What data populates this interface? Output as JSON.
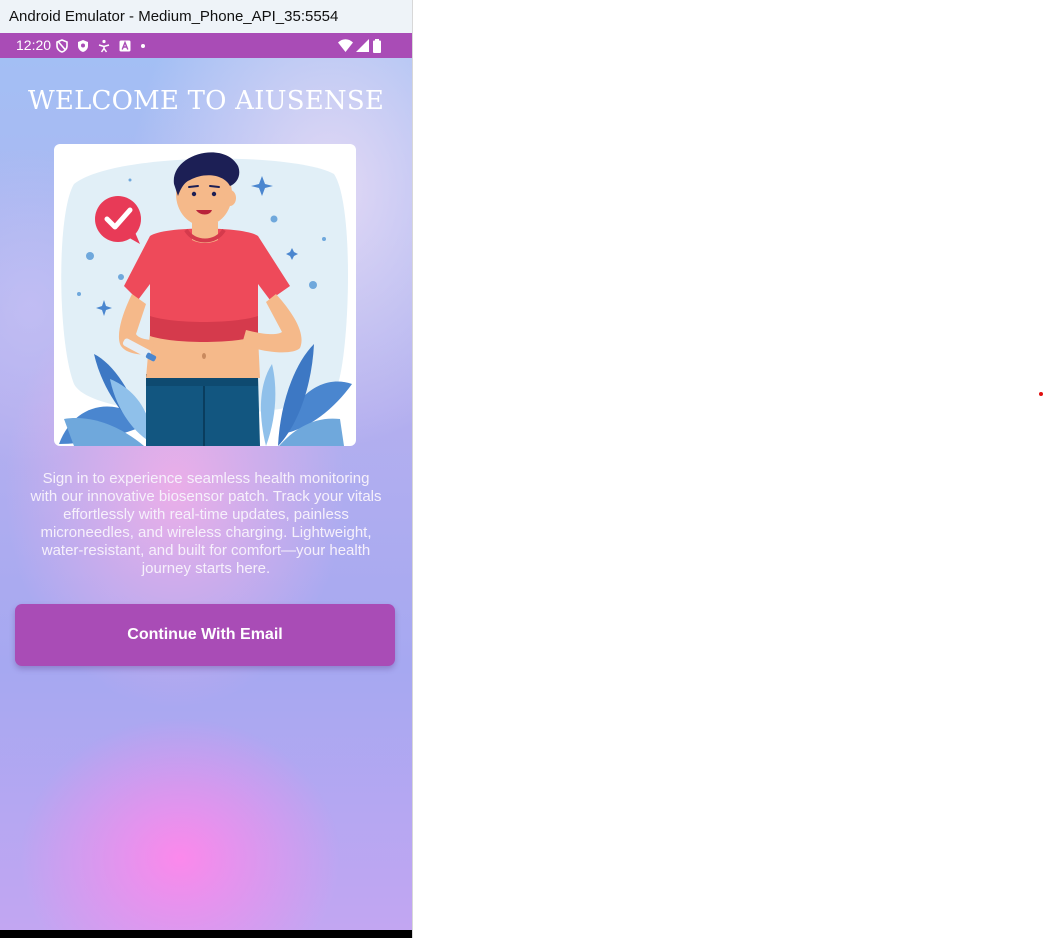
{
  "window": {
    "title": "Android Emulator - Medium_Phone_API_35:5554"
  },
  "status_bar": {
    "time": "12:20",
    "left_icons": [
      "dnd-shield-icon",
      "vpn-shield-icon",
      "accessibility-icon",
      "a-badge-icon",
      "dot-icon"
    ],
    "right_icons": [
      "wifi-icon",
      "cell-signal-icon",
      "battery-icon"
    ],
    "color": "#a94cb6"
  },
  "screen": {
    "title": "WELCOME TO AIUSENSE",
    "description": "Sign in to experience seamless health monitoring with our innovative biosensor patch. Track your vitals effortlessly with real-time updates, painless microneedles, and wireless charging. Lightweight, water-resistant, and built for comfort—your health journey starts here.",
    "continue_button": "Continue With Email",
    "accent_color": "#a94cb6"
  }
}
